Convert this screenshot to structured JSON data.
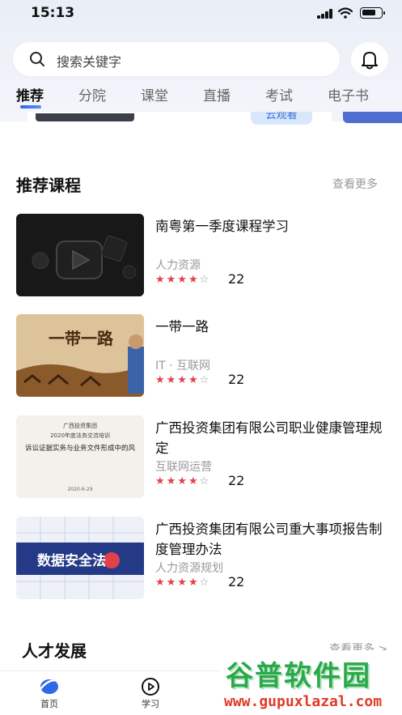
{
  "status_bar": {
    "time": "15:13"
  },
  "search": {
    "placeholder": "搜索关键字"
  },
  "tabs": [
    {
      "label": "推荐",
      "active": true
    },
    {
      "label": "分院",
      "active": false
    },
    {
      "label": "课堂",
      "active": false
    },
    {
      "label": "直播",
      "active": false
    },
    {
      "label": "考试",
      "active": false
    },
    {
      "label": "电子书",
      "active": false
    }
  ],
  "banner": {
    "pill_label": "云观看"
  },
  "recommended": {
    "title": "推荐课程",
    "more": "查看更多",
    "courses": [
      {
        "title": "南粤第一季度课程学习",
        "category": "人力资源",
        "rating": 4,
        "count": "22",
        "thumb_text": ""
      },
      {
        "title": "一带一路",
        "category": "IT · 互联网",
        "rating": 4,
        "count": "22",
        "thumb_text": "一带一路"
      },
      {
        "title": "广西投资集团有限公司职业健康管理规定",
        "category": "互联网运营",
        "rating": 4,
        "count": "22",
        "thumb_text": "2020年度法务交流培训",
        "thumb_sub": "诉讼证据实务与业务文件形成中的风",
        "thumb_org": "广西投资集团",
        "thumb_date": "2020-6-29"
      },
      {
        "title": "广西投资集团有限公司重大事项报告制度管理办法",
        "category": "人力资源规划",
        "rating": 4,
        "count": "22",
        "thumb_text": "数据安全法"
      }
    ]
  },
  "talent": {
    "title": "人才发展",
    "more": "查看更多 >"
  },
  "tabbar": [
    {
      "label": "首页",
      "icon": "home-logo-icon"
    },
    {
      "label": "学习",
      "icon": "play-circle-icon"
    }
  ],
  "watermark": {
    "title": "谷普软件园",
    "url": "www.gupuxlazal.com"
  },
  "colors": {
    "accent": "#2e6ae6",
    "star": "#e0424a",
    "muted": "#999999"
  }
}
